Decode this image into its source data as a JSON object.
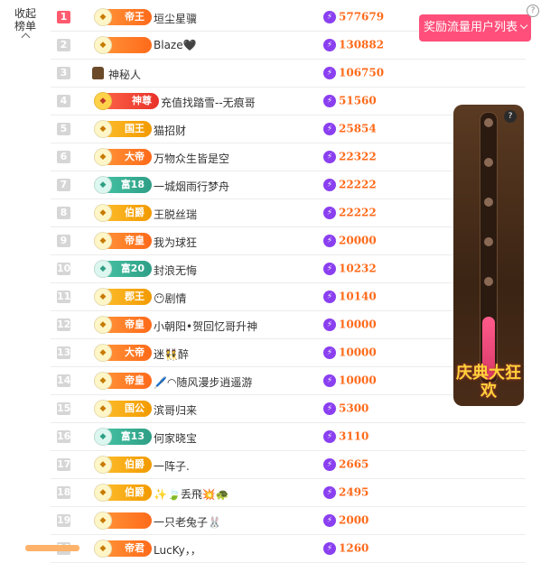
{
  "collapse_label": "收起\n榜单",
  "collapse_line1": "收起",
  "collapse_line2": "榜单",
  "reward_button": "奖励流量用户列表",
  "widget_help": "?",
  "widget_logo": "庆典大狂欢",
  "rows": [
    {
      "rank": "1",
      "badge": "帝王",
      "badge_style": "orange",
      "name": "垣尘星骥",
      "score": "577679"
    },
    {
      "rank": "2",
      "badge": "",
      "badge_style": "orange",
      "name": "Blaze🖤",
      "score": "130882"
    },
    {
      "rank": "3",
      "badge": "",
      "badge_style": "none",
      "name": "神秘人",
      "score": "106750"
    },
    {
      "rank": "4",
      "badge": "神尊",
      "badge_style": "red",
      "name": "充值找踏雪--无痕哥",
      "score": "51560"
    },
    {
      "rank": "5",
      "badge": "国王",
      "badge_style": "gold",
      "name": "猫招财",
      "score": "25854"
    },
    {
      "rank": "6",
      "badge": "大帝",
      "badge_style": "orange",
      "name": "万物众生皆是空",
      "score": "22322"
    },
    {
      "rank": "7",
      "badge": "富18",
      "badge_style": "teal",
      "name": "一城烟雨行梦舟",
      "score": "22222"
    },
    {
      "rank": "8",
      "badge": "伯爵",
      "badge_style": "gold",
      "name": "王脱丝瑞",
      "score": "22222"
    },
    {
      "rank": "9",
      "badge": "帝皇",
      "badge_style": "orange",
      "name": "我为球狂",
      "score": "20000"
    },
    {
      "rank": "10",
      "badge": "富20",
      "badge_style": "teal",
      "name": "封浪无悔",
      "score": "10232"
    },
    {
      "rank": "11",
      "badge": "郡王",
      "badge_style": "gold",
      "name": "😶剧情",
      "score": "10140"
    },
    {
      "rank": "12",
      "badge": "帝皇",
      "badge_style": "orange",
      "name": "小朝阳•贺回忆哥升神",
      "score": "10000"
    },
    {
      "rank": "13",
      "badge": "大帝",
      "badge_style": "orange",
      "name": "迷👯醉",
      "score": "10000"
    },
    {
      "rank": "14",
      "badge": "帝皇",
      "badge_style": "orange",
      "name": "🖊️◠随风漫步逍遥游",
      "score": "10000"
    },
    {
      "rank": "15",
      "badge": "国公",
      "badge_style": "gold",
      "name": "滨哥归来",
      "score": "5300"
    },
    {
      "rank": "16",
      "badge": "富13",
      "badge_style": "teal",
      "name": "何家晓宝",
      "score": "3110"
    },
    {
      "rank": "17",
      "badge": "伯爵",
      "badge_style": "gold",
      "name": "一阵子.",
      "score": "2665"
    },
    {
      "rank": "18",
      "badge": "伯爵",
      "badge_style": "gold",
      "name": "✨🍃丢飛💥🐢",
      "score": "2495"
    },
    {
      "rank": "19",
      "badge": "",
      "badge_style": "orange",
      "name": "一只老兔子🐰",
      "score": "2000"
    },
    {
      "rank": "20",
      "badge": "帝君",
      "badge_style": "orange",
      "name": "LucKy，，",
      "score": "1260"
    }
  ]
}
